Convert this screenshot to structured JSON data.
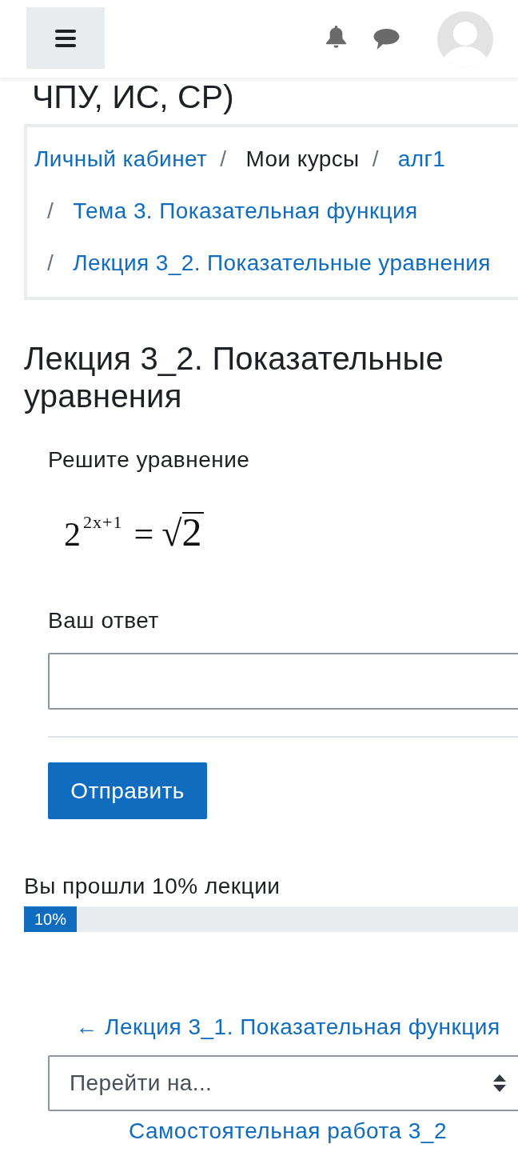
{
  "page_title": "ЧПУ, ИС, СР)",
  "breadcrumb": [
    {
      "label": "Личный кабинет",
      "kind": "link"
    },
    {
      "separator": "/",
      "label": "Мои курсы",
      "kind": "text"
    },
    {
      "separator": "/",
      "label": "алг1",
      "kind": "link"
    },
    {
      "separator": "/",
      "label": "Тема 3. Показательная функция",
      "kind": "link"
    },
    {
      "separator": "/",
      "label": "Лекция 3_2. Показательные уравнения",
      "kind": "link"
    }
  ],
  "lesson_title": "Лекция 3_2. Показательные уравнения",
  "question": {
    "prompt": "Решите уравнение",
    "equation": {
      "base": "2",
      "exponent": "2x+1",
      "relation": "=",
      "radical": "√",
      "radicand": "2"
    },
    "answer_label": "Ваш ответ",
    "submit_button": "Отправить"
  },
  "progress": {
    "label": "Вы прошли 10% лекции",
    "level": 0.1,
    "bar_text": "10%"
  },
  "navigation": {
    "previous_link": "← Лекция 3_1. Показательная функция",
    "jump_select": {
      "value": "Перейти на..."
    },
    "next_link": "Самостоятельная работа 3_2"
  }
}
